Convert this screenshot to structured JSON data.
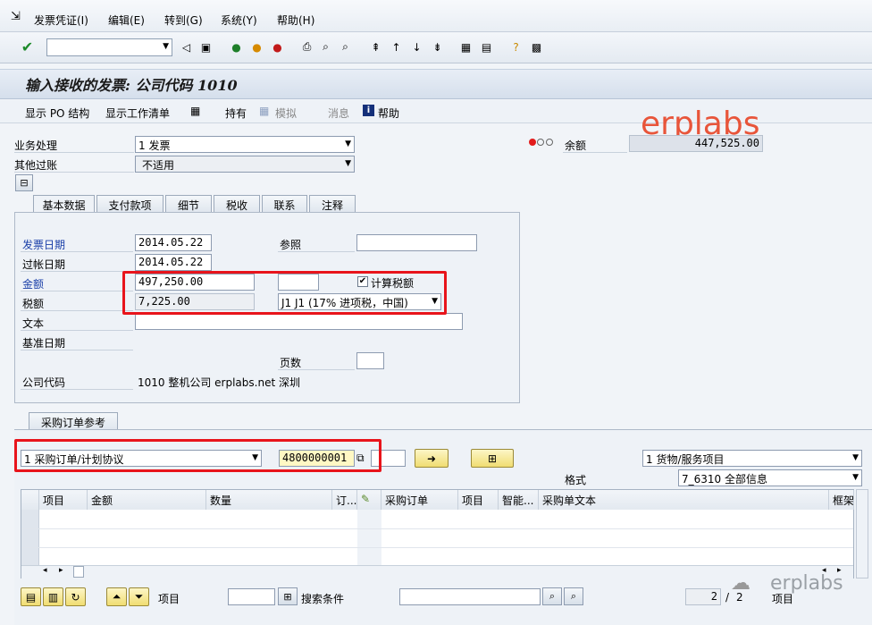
{
  "menu": [
    "发票凭证(I)",
    "编辑(E)",
    "转到(G)",
    "系统(Y)",
    "帮助(H)"
  ],
  "title": "输入接收的发票: 公司代码 1010",
  "app_toolbar": {
    "show_po_structure": "显示 PO 结构",
    "show_worklist": "显示工作清单",
    "hold": "持有",
    "simulate": "模拟",
    "messages": "消息",
    "help": "帮助"
  },
  "watermark": "erplabs",
  "header": {
    "transaction_label": "业务处理",
    "transaction_value": "1 发票",
    "other_posting_label": "其他过账",
    "other_posting_value": "不适用",
    "balance_label": "余额",
    "balance_value": "447,525.00"
  },
  "tabs": [
    "基本数据",
    "支付款项",
    "细节",
    "税收",
    "联系",
    "注释"
  ],
  "basic": {
    "invoice_date_label": "发票日期",
    "invoice_date": "2014.05.22",
    "reference_label": "参照",
    "reference": "",
    "posting_date_label": "过帐日期",
    "posting_date": "2014.05.22",
    "amount_label": "金额",
    "amount": "497,250.00",
    "currency": "",
    "calc_tax_label": "计算税额",
    "tax_label": "税额",
    "tax_amount": "7,225.00",
    "tax_code": "J1 J1 (17% 进项税，中国)",
    "text_label": "文本",
    "baseline_label": "基准日期",
    "page_label": "页数",
    "company_label": "公司代码",
    "company_value": "1010 整机公司 erplabs.net 深圳"
  },
  "po_ref": {
    "tab": "采购订单参考",
    "ref_type": "1 采购订单/计划协议",
    "po_number": "4800000001",
    "item_type": "1 货物/服务项目",
    "layout_label": "格式",
    "layout_value": "7_6310 全部信息",
    "columns": [
      "项目",
      "金额",
      "数量",
      "订...",
      "",
      "采购订单",
      "项目",
      "智能...",
      "采购单文本",
      "框架"
    ]
  },
  "footer": {
    "item_label": "项目",
    "search_label": "搜索条件",
    "page_current": "2",
    "page_sep": "/",
    "page_total": "2",
    "items_label": "项目",
    "wechat_brand": "erplabs"
  },
  "colors": {
    "accent_red": "#e8141b",
    "watermark": "#e8553a",
    "label_blue": "#1a3fa8"
  }
}
